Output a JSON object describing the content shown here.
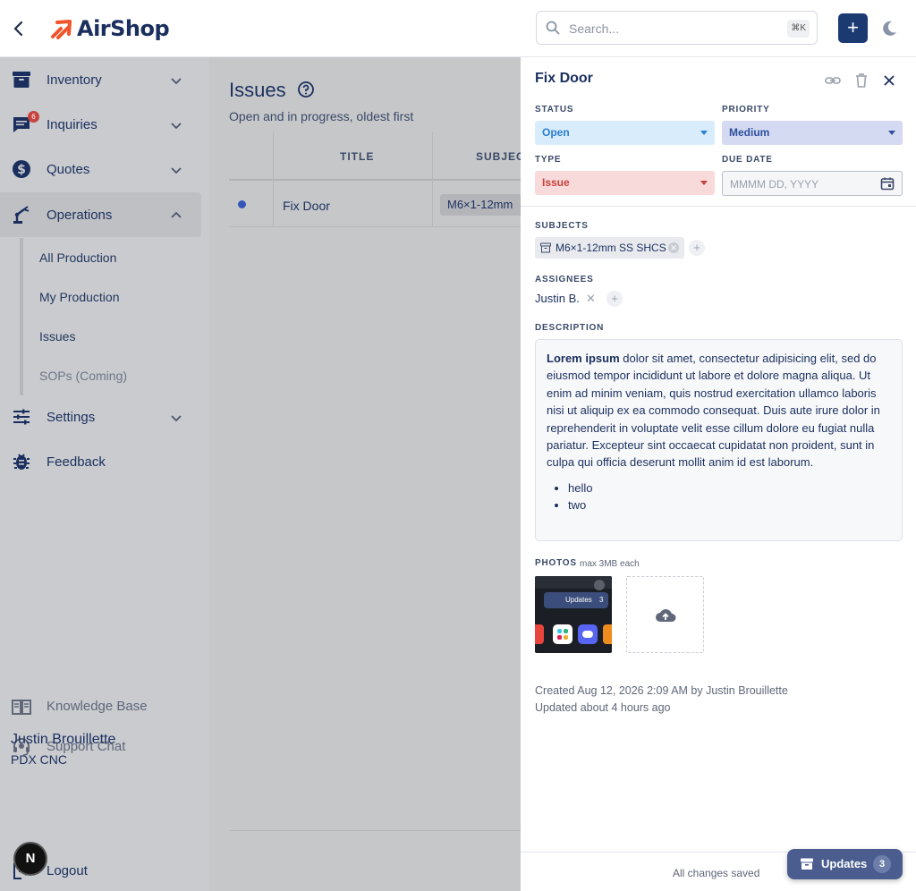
{
  "header": {
    "brand": "AirShop",
    "search_placeholder": "Search...",
    "search_shortcut": "⌘K",
    "add_label": "+"
  },
  "sidebar": {
    "items": [
      {
        "label": "Inventory",
        "icon": "archive-icon"
      },
      {
        "label": "Inquiries",
        "icon": "chat-icon",
        "badge": "6"
      },
      {
        "label": "Quotes",
        "icon": "dollar-icon"
      },
      {
        "label": "Operations",
        "icon": "robot-arm-icon"
      },
      {
        "label": "Settings",
        "icon": "sliders-icon"
      },
      {
        "label": "Feedback",
        "icon": "bug-icon"
      }
    ],
    "operations_subitems": [
      "All Production",
      "My Production",
      "Issues",
      "SOPs (Coming)"
    ],
    "footer_links": [
      "Knowledge Base",
      "Support Chat"
    ],
    "user": {
      "name": "Justin Brouillette",
      "org": "PDX CNC",
      "avatar_letter": "N"
    },
    "logout_label": "Logout"
  },
  "main": {
    "title": "Issues",
    "subtitle": "Open and in progress, oldest first",
    "columns": [
      "TITLE",
      "SUBJEC"
    ],
    "rows": [
      {
        "title": "Fix Door",
        "subject": "M6×1-12mm"
      }
    ]
  },
  "panel": {
    "title": "Fix Door",
    "status_label": "STATUS",
    "status_value": "Open",
    "priority_label": "PRIORITY",
    "priority_value": "Medium",
    "type_label": "TYPE",
    "type_value": "Issue",
    "due_label": "DUE DATE",
    "due_placeholder": "MMMM DD, YYYY",
    "subjects_label": "SUBJECTS",
    "subject_chip": "M6×1-12mm SS SHCS",
    "assignees_label": "ASSIGNEES",
    "assignee": "Justin B.",
    "description_label": "DESCRIPTION",
    "description_bold": "Lorem ipsum",
    "description_text": " dolor sit amet, consectetur adipisicing elit, sed do eiusmod tempor incididunt ut labore et dolore magna aliqua. Ut enim ad minim veniam, quis nostrud exercitation ullamco laboris nisi ut aliquip ex ea commodo consequat. Duis aute irure dolor in reprehenderit in voluptate velit esse cillum dolore eu fugiat nulla pariatur. Excepteur sint occaecat cupidatat non proident, sunt in culpa qui officia deserunt mollit anim id est laborum.",
    "description_list": [
      "hello",
      "two"
    ],
    "photos_label": "PHOTOS",
    "photos_hint": "max 3MB each",
    "thumb_label": "Updates",
    "thumb_count": "3",
    "created": "Created Aug 12, 2026 2:09 AM by Justin Brouillette",
    "updated": "Updated about 4 hours ago",
    "saved_text": "All changes saved",
    "updates_label": "Updates",
    "updates_count": "3"
  },
  "colors": {
    "brand_navy": "#1b2f5e",
    "brand_orange": "#f0542b",
    "status_blue": "#2a7fd0",
    "priority_indigo": "#2e4e9e",
    "type_red": "#c6403b"
  }
}
